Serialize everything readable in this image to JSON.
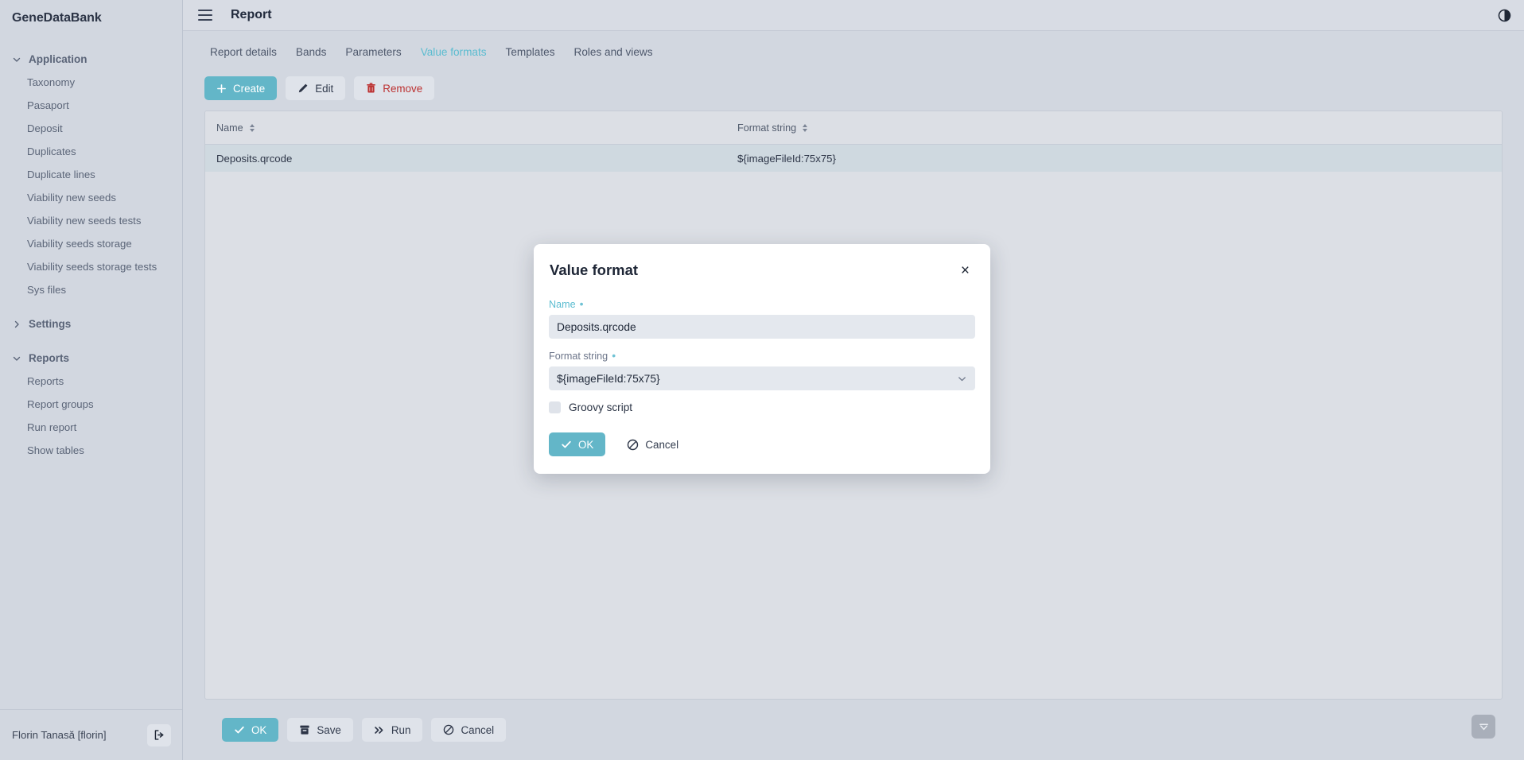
{
  "sidebar": {
    "brand": "GeneDataBank",
    "groups": [
      {
        "label": "Application",
        "expanded": true,
        "icon": "chevron-down-icon",
        "items": [
          {
            "label": "Taxonomy"
          },
          {
            "label": "Pasaport"
          },
          {
            "label": "Deposit"
          },
          {
            "label": "Duplicates"
          },
          {
            "label": "Duplicate lines"
          },
          {
            "label": "Viability new seeds"
          },
          {
            "label": "Viability new seeds tests"
          },
          {
            "label": "Viability seeds storage"
          },
          {
            "label": "Viability seeds storage tests"
          },
          {
            "label": "Sys files"
          }
        ]
      },
      {
        "label": "Settings",
        "expanded": false,
        "icon": "chevron-right-icon",
        "items": []
      },
      {
        "label": "Reports",
        "expanded": true,
        "icon": "chevron-down-icon",
        "items": [
          {
            "label": "Reports"
          },
          {
            "label": "Report groups"
          },
          {
            "label": "Run report"
          },
          {
            "label": "Show tables"
          }
        ]
      }
    ],
    "user": {
      "name": "Florin Tanasă [florin]",
      "logout_icon": "logout-icon"
    }
  },
  "topbar": {
    "menu_icon": "hamburger-menu-icon",
    "title": "Report",
    "theme_icon": "contrast-toggle-icon"
  },
  "tabs": [
    {
      "label": "Report details",
      "active": false
    },
    {
      "label": "Bands",
      "active": false
    },
    {
      "label": "Parameters",
      "active": false
    },
    {
      "label": "Value formats",
      "active": true
    },
    {
      "label": "Templates",
      "active": false
    },
    {
      "label": "Roles and views",
      "active": false
    }
  ],
  "toolbar": {
    "create_label": "Create",
    "create_icon": "plus-icon",
    "edit_label": "Edit",
    "edit_icon": "pencil-icon",
    "remove_label": "Remove",
    "remove_icon": "trash-icon"
  },
  "table": {
    "columns": [
      {
        "label": "Name",
        "sort_icon": "sort-arrows-icon"
      },
      {
        "label": "Format string",
        "sort_icon": "sort-arrows-icon"
      }
    ],
    "rows": [
      {
        "name": "Deposits.qrcode",
        "format_string": "${imageFileId:75x75}",
        "selected": true
      }
    ]
  },
  "bottombar": {
    "ok_label": "OK",
    "ok_icon": "check-icon",
    "save_label": "Save",
    "save_icon": "archive-box-icon",
    "run_label": "Run",
    "run_icon": "double-chevron-right-icon",
    "cancel_label": "Cancel",
    "cancel_icon": "cancel-circle-icon",
    "scroll_icon": "chevron-down-icon"
  },
  "modal": {
    "title": "Value format",
    "close_icon": "close-icon",
    "name_field": {
      "label": "Name",
      "required_marker": "•",
      "value": "Deposits.qrcode",
      "placeholder": ""
    },
    "format_field": {
      "label": "Format string",
      "required_marker": "•",
      "value": "${imageFileId:75x75}",
      "chevron_icon": "chevron-down-icon"
    },
    "groovy": {
      "label": "Groovy script",
      "checked": false
    },
    "ok_label": "OK",
    "ok_icon": "check-icon",
    "cancel_label": "Cancel",
    "cancel_icon": "cancel-circle-icon"
  },
  "colors": {
    "accent": "#63b6c8",
    "active_tab": "#5bbcd0",
    "danger": "#bc3131",
    "page_bg": "#d2d7e0",
    "sidebar_bg": "#d2d7e0",
    "panel_bg": "#dcdfe5",
    "row_selected": "#cfd9e0",
    "input_bg": "#e4e8ee",
    "modal_bg": "#ffffff"
  }
}
